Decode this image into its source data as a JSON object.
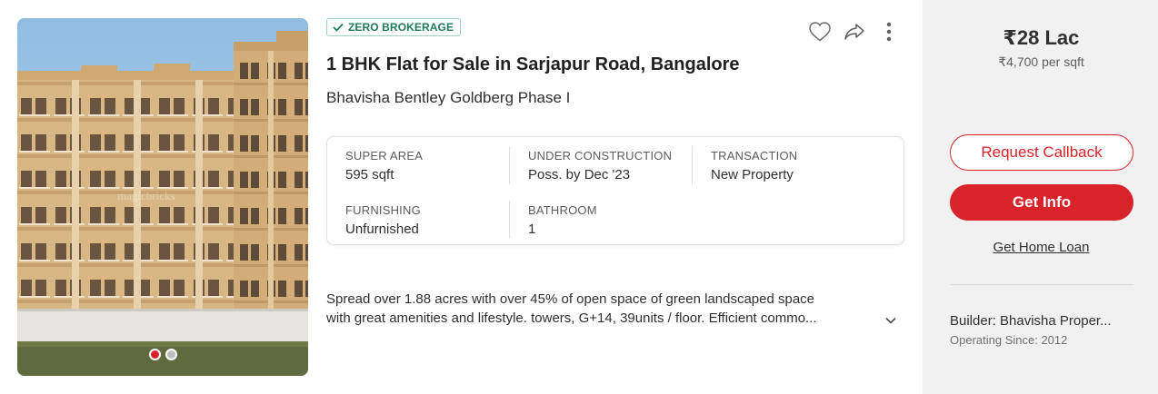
{
  "listing": {
    "badge": "ZERO BROKERAGE",
    "title": "1 BHK Flat for Sale in Sarjapur Road, Bangalore",
    "project": "Bhavisha Bentley Goldberg Phase I",
    "image": {
      "slide_count": 2,
      "active_slide": 1,
      "watermark": "magicbricks"
    },
    "summary": [
      {
        "label": "SUPER AREA",
        "value": "595 sqft"
      },
      {
        "label": "UNDER CONSTRUCTION",
        "value": "Poss. by Dec '23"
      },
      {
        "label": "TRANSACTION",
        "value": "New Property"
      },
      {
        "label": "FURNISHING",
        "value": "Unfurnished"
      },
      {
        "label": "BATHROOM",
        "value": "1"
      }
    ],
    "description": {
      "line1": "Spread over 1.88 acres with over 45% of open space of green landscaped space",
      "line2": "with great amenities and lifestyle. towers, G+14, 39units / floor. Efficient commo..."
    },
    "icons": {
      "favorite": "heart-icon",
      "share": "share-icon",
      "menu": "more-vertical-icon",
      "expand": "chevron-down-icon",
      "verified": "check-icon"
    }
  },
  "pricing": {
    "price": "₹28 Lac",
    "per_sqft": "₹4,700 per sqft"
  },
  "cta": {
    "callback": "Request Callback",
    "info": "Get Info",
    "loan": "Get Home Loan"
  },
  "builder": {
    "name": "Builder: Bhavisha Proper...",
    "since": "Operating Since: 2012"
  },
  "colors": {
    "accent": "#d8232a",
    "badge_green": "#1f7b58",
    "side_bg": "#f1f1f1"
  }
}
